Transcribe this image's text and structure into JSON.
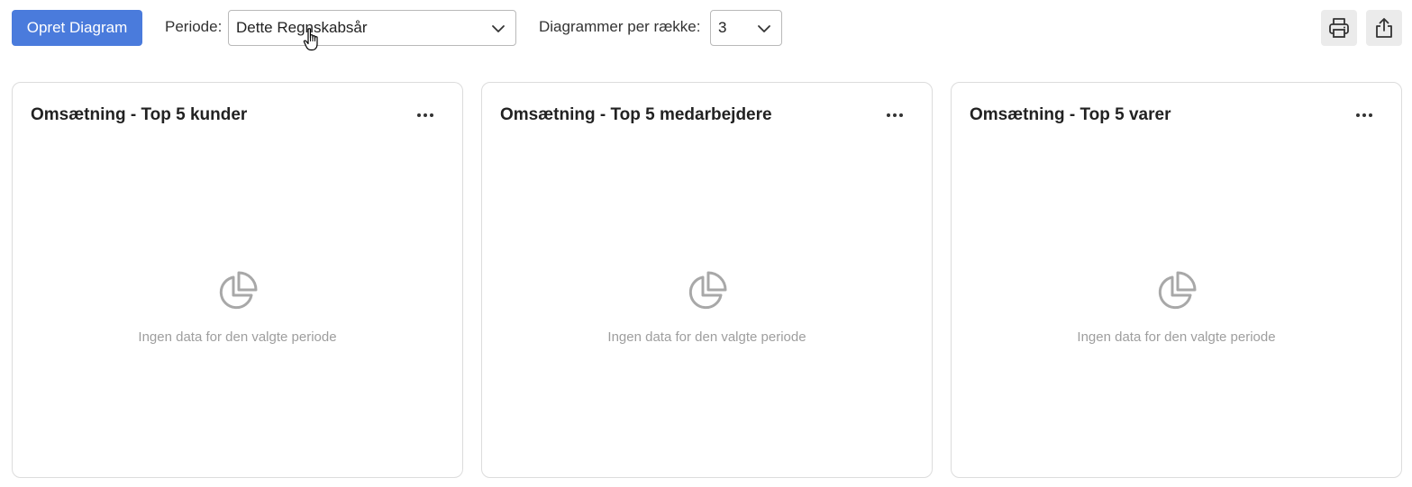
{
  "toolbar": {
    "create_button_label": "Opret Diagram",
    "period_label": "Periode:",
    "period_value": "Dette Regnskabsår",
    "per_row_label": "Diagrammer per række:",
    "per_row_value": "3",
    "print_icon": "printer-icon",
    "share_icon": "share-icon"
  },
  "colors": {
    "primary": "#4a7bdc",
    "empty_text": "#9e9e9e",
    "icon_button_bg": "#ebebeb"
  },
  "cards": [
    {
      "title": "Omsætning - Top 5 kunder",
      "empty_message": "Ingen data for den valgte periode",
      "icon": "pie-chart-icon"
    },
    {
      "title": "Omsætning - Top 5 medarbejdere",
      "empty_message": "Ingen data for den valgte periode",
      "icon": "pie-chart-icon"
    },
    {
      "title": "Omsætning - Top 5 varer",
      "empty_message": "Ingen data for den valgte periode",
      "icon": "pie-chart-icon"
    }
  ]
}
